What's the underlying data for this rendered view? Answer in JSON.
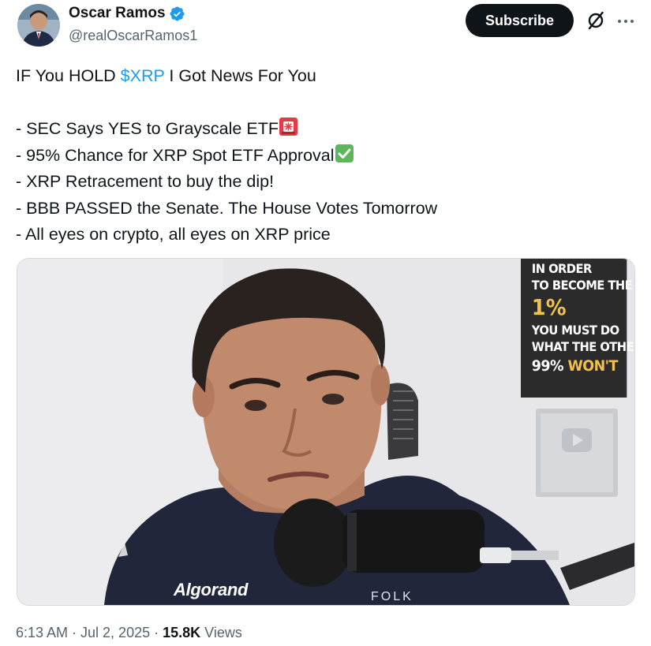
{
  "author": {
    "display_name": "Oscar Ramos",
    "handle": "@realOscarRamos1",
    "verified_icon": "verified-badge-icon",
    "avatar_icon": "avatar-photo"
  },
  "actions": {
    "subscribe_label": "Subscribe",
    "grok_icon": "grok-icon",
    "more_icon": "more-dots-icon"
  },
  "tweet": {
    "line1_prefix": "IF You HOLD ",
    "cashtag": "$XRP",
    "line1_suffix": " I Got News For You",
    "bullets": [
      "- SEC Says YES to Grayscale ETF",
      "- 95% Chance for XRP Spot ETF Approval",
      "- XRP Retracement to buy the dip!",
      "- BBB PASSED the Senate. The House Votes Tomorrow",
      "- All eyes on crypto, all eyes on XRP price"
    ],
    "emoji_1": "rotating-light-icon",
    "emoji_2": "check-mark-button-icon"
  },
  "media": {
    "poster_line1": "IN ORDER",
    "poster_line2": "TO BECOME THE",
    "poster_big": "1%",
    "poster_line3": "YOU MUST DO",
    "poster_line4": "WHAT THE OTHER",
    "poster_bottom_a": "99% ",
    "poster_bottom_b": "WON'T",
    "shirt_brand": "Algorand",
    "shirt_sub": "FOLK"
  },
  "meta": {
    "time_date": "6:13 AM · Jul 2, 2025 · ",
    "views_count": "15.8K",
    "views_label": " Views"
  },
  "colors": {
    "accent": "#1d9bf0",
    "text": "#0f1419",
    "secondary": "#536471",
    "poster_yellow": "#f1c24a"
  }
}
